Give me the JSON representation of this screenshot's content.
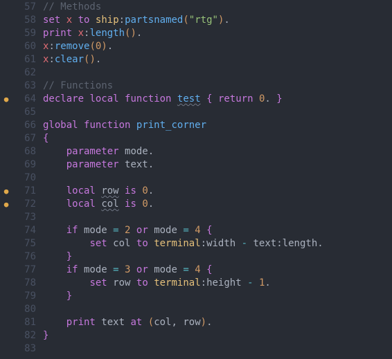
{
  "editor": {
    "lines": [
      {
        "n": 57,
        "annot": "",
        "tokens": [
          [
            "c-comment",
            "// Methods"
          ]
        ]
      },
      {
        "n": 58,
        "annot": "",
        "tokens": [
          [
            "c-kw",
            "set"
          ],
          [
            "c-plain",
            " "
          ],
          [
            "c-var",
            "x"
          ],
          [
            "c-plain",
            " "
          ],
          [
            "c-kw",
            "to"
          ],
          [
            "c-plain",
            " "
          ],
          [
            "c-obj",
            "ship"
          ],
          [
            "c-punc",
            ":"
          ],
          [
            "c-func",
            "partsnamed"
          ],
          [
            "c-paren",
            "("
          ],
          [
            "c-str",
            "\"rtg\""
          ],
          [
            "c-paren",
            ")"
          ],
          [
            "c-punc",
            "."
          ]
        ]
      },
      {
        "n": 59,
        "annot": "",
        "tokens": [
          [
            "c-kw",
            "print"
          ],
          [
            "c-plain",
            " "
          ],
          [
            "c-var",
            "x"
          ],
          [
            "c-punc",
            ":"
          ],
          [
            "c-func",
            "length"
          ],
          [
            "c-paren",
            "()"
          ],
          [
            "c-punc",
            "."
          ]
        ]
      },
      {
        "n": 60,
        "annot": "",
        "tokens": [
          [
            "c-var",
            "x"
          ],
          [
            "c-punc",
            ":"
          ],
          [
            "c-func",
            "remove"
          ],
          [
            "c-paren",
            "("
          ],
          [
            "c-num",
            "0"
          ],
          [
            "c-paren",
            ")"
          ],
          [
            "c-punc",
            "."
          ]
        ]
      },
      {
        "n": 61,
        "annot": "",
        "tokens": [
          [
            "c-var",
            "x"
          ],
          [
            "c-punc",
            ":"
          ],
          [
            "c-func",
            "clear"
          ],
          [
            "c-paren",
            "()"
          ],
          [
            "c-punc",
            "."
          ]
        ]
      },
      {
        "n": 62,
        "annot": "",
        "tokens": []
      },
      {
        "n": 63,
        "annot": "",
        "tokens": [
          [
            "c-comment",
            "// Functions"
          ]
        ]
      },
      {
        "n": 64,
        "annot": "warn",
        "tokens": [
          [
            "c-kw",
            "declare"
          ],
          [
            "c-plain",
            " "
          ],
          [
            "c-kw",
            "local"
          ],
          [
            "c-plain",
            " "
          ],
          [
            "c-kw",
            "function"
          ],
          [
            "c-plain",
            " "
          ],
          [
            "c-func squiggle",
            "test"
          ],
          [
            "c-plain",
            " "
          ],
          [
            "c-brace",
            "{"
          ],
          [
            "c-plain",
            " "
          ],
          [
            "c-kw",
            "return"
          ],
          [
            "c-plain",
            " "
          ],
          [
            "c-num",
            "0"
          ],
          [
            "c-punc",
            "."
          ],
          [
            "c-plain",
            " "
          ],
          [
            "c-brace",
            "}"
          ]
        ]
      },
      {
        "n": 65,
        "annot": "",
        "tokens": []
      },
      {
        "n": 66,
        "annot": "",
        "tokens": [
          [
            "c-kw",
            "global"
          ],
          [
            "c-plain",
            " "
          ],
          [
            "c-kw",
            "function"
          ],
          [
            "c-plain",
            " "
          ],
          [
            "c-func",
            "print_corner"
          ]
        ]
      },
      {
        "n": 67,
        "annot": "",
        "tokens": [
          [
            "c-brace",
            "{"
          ]
        ]
      },
      {
        "n": 68,
        "annot": "",
        "tokens": [
          [
            "c-plain",
            "    "
          ],
          [
            "c-kw",
            "parameter"
          ],
          [
            "c-plain",
            " "
          ],
          [
            "c-plain",
            "mode"
          ],
          [
            "c-punc",
            "."
          ]
        ]
      },
      {
        "n": 69,
        "annot": "",
        "tokens": [
          [
            "c-plain",
            "    "
          ],
          [
            "c-kw",
            "parameter"
          ],
          [
            "c-plain",
            " "
          ],
          [
            "c-plain",
            "text"
          ],
          [
            "c-punc",
            "."
          ]
        ]
      },
      {
        "n": 70,
        "annot": "",
        "tokens": []
      },
      {
        "n": 71,
        "annot": "warn",
        "tokens": [
          [
            "c-plain",
            "    "
          ],
          [
            "c-kw",
            "local"
          ],
          [
            "c-plain",
            " "
          ],
          [
            "c-plain squiggle",
            "row"
          ],
          [
            "c-plain",
            " "
          ],
          [
            "c-kw",
            "is"
          ],
          [
            "c-plain",
            " "
          ],
          [
            "c-num",
            "0"
          ],
          [
            "c-punc",
            "."
          ]
        ]
      },
      {
        "n": 72,
        "annot": "warn",
        "tokens": [
          [
            "c-plain",
            "    "
          ],
          [
            "c-kw",
            "local"
          ],
          [
            "c-plain",
            " "
          ],
          [
            "c-plain squiggle",
            "col"
          ],
          [
            "c-plain",
            " "
          ],
          [
            "c-kw",
            "is"
          ],
          [
            "c-plain",
            " "
          ],
          [
            "c-num",
            "0"
          ],
          [
            "c-punc",
            "."
          ]
        ]
      },
      {
        "n": 73,
        "annot": "",
        "tokens": []
      },
      {
        "n": 74,
        "annot": "",
        "tokens": [
          [
            "c-plain",
            "    "
          ],
          [
            "c-kw",
            "if"
          ],
          [
            "c-plain",
            " mode "
          ],
          [
            "c-op",
            "="
          ],
          [
            "c-plain",
            " "
          ],
          [
            "c-num",
            "2"
          ],
          [
            "c-plain",
            " "
          ],
          [
            "c-kw",
            "or"
          ],
          [
            "c-plain",
            " mode "
          ],
          [
            "c-op",
            "="
          ],
          [
            "c-plain",
            " "
          ],
          [
            "c-num",
            "4"
          ],
          [
            "c-plain",
            " "
          ],
          [
            "c-brace",
            "{"
          ]
        ]
      },
      {
        "n": 75,
        "annot": "",
        "tokens": [
          [
            "c-plain",
            "        "
          ],
          [
            "c-kw",
            "set"
          ],
          [
            "c-plain",
            " col "
          ],
          [
            "c-kw",
            "to"
          ],
          [
            "c-plain",
            " "
          ],
          [
            "c-obj",
            "terminal"
          ],
          [
            "c-punc",
            ":"
          ],
          [
            "c-plain",
            "width "
          ],
          [
            "c-op",
            "-"
          ],
          [
            "c-plain",
            " text"
          ],
          [
            "c-punc",
            ":"
          ],
          [
            "c-plain",
            "length"
          ],
          [
            "c-punc",
            "."
          ]
        ]
      },
      {
        "n": 76,
        "annot": "",
        "tokens": [
          [
            "c-plain",
            "    "
          ],
          [
            "c-brace",
            "}"
          ]
        ]
      },
      {
        "n": 77,
        "annot": "",
        "tokens": [
          [
            "c-plain",
            "    "
          ],
          [
            "c-kw",
            "if"
          ],
          [
            "c-plain",
            " mode "
          ],
          [
            "c-op",
            "="
          ],
          [
            "c-plain",
            " "
          ],
          [
            "c-num",
            "3"
          ],
          [
            "c-plain",
            " "
          ],
          [
            "c-kw",
            "or"
          ],
          [
            "c-plain",
            " mode "
          ],
          [
            "c-op",
            "="
          ],
          [
            "c-plain",
            " "
          ],
          [
            "c-num",
            "4"
          ],
          [
            "c-plain",
            " "
          ],
          [
            "c-brace",
            "{"
          ]
        ]
      },
      {
        "n": 78,
        "annot": "",
        "tokens": [
          [
            "c-plain",
            "        "
          ],
          [
            "c-kw",
            "set"
          ],
          [
            "c-plain",
            " row "
          ],
          [
            "c-kw",
            "to"
          ],
          [
            "c-plain",
            " "
          ],
          [
            "c-obj",
            "terminal"
          ],
          [
            "c-punc",
            ":"
          ],
          [
            "c-plain",
            "height "
          ],
          [
            "c-op",
            "-"
          ],
          [
            "c-plain",
            " "
          ],
          [
            "c-num",
            "1"
          ],
          [
            "c-punc",
            "."
          ]
        ]
      },
      {
        "n": 79,
        "annot": "",
        "tokens": [
          [
            "c-plain",
            "    "
          ],
          [
            "c-brace",
            "}"
          ]
        ]
      },
      {
        "n": 80,
        "annot": "",
        "tokens": []
      },
      {
        "n": 81,
        "annot": "",
        "tokens": [
          [
            "c-plain",
            "    "
          ],
          [
            "c-kw",
            "print"
          ],
          [
            "c-plain",
            " text "
          ],
          [
            "c-kw",
            "at"
          ],
          [
            "c-plain",
            " "
          ],
          [
            "c-paren",
            "("
          ],
          [
            "c-plain",
            "col"
          ],
          [
            "c-punc",
            ","
          ],
          [
            "c-plain",
            " row"
          ],
          [
            "c-paren",
            ")"
          ],
          [
            "c-punc",
            "."
          ]
        ]
      },
      {
        "n": 82,
        "annot": "",
        "tokens": [
          [
            "c-brace",
            "}"
          ]
        ]
      },
      {
        "n": 83,
        "annot": "",
        "tokens": []
      }
    ],
    "annotGlyph": "●"
  }
}
